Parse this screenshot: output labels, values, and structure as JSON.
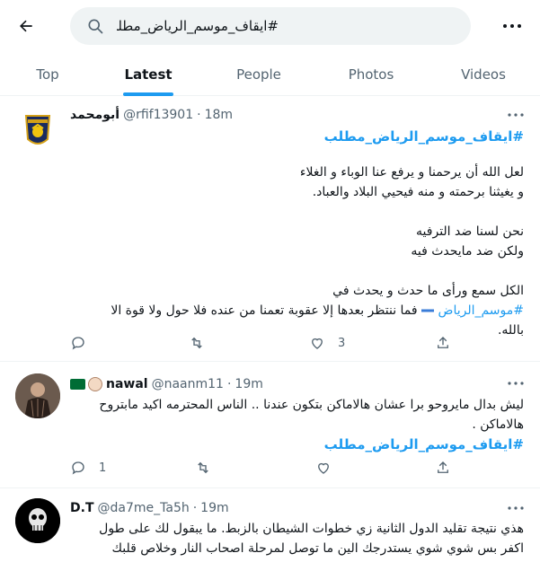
{
  "search": {
    "query": "#ايقاف_موسم_الرياض_مطلب"
  },
  "tabs": [
    {
      "label": "Top",
      "active": false
    },
    {
      "label": "Latest",
      "active": true
    },
    {
      "label": "People",
      "active": false
    },
    {
      "label": "Photos",
      "active": false
    },
    {
      "label": "Videos",
      "active": false
    }
  ],
  "tweets": [
    {
      "name": "أبومحمد",
      "handle": "@rfif13901",
      "time": "18m",
      "hashtag": "#ايقاف_موسم_الرياض_مطلب",
      "lines": [
        "لعل الله أن يرحمنا و يرفع عنا الوباء و الغلاء",
        "و يغيثنا برحمته و منه فيحيي البلاد والعباد.",
        "نحن لسنا ضد الترفيه",
        "ولكن ضد مايحدث فيه",
        "الكل سمع ورأى ما حدث و يحدث في"
      ],
      "link_hashtag": "#موسم_الرياض",
      "link_tail": "فما ننتظر بعدها إلا عقوبة تعمنا من عنده فلا حول ولا قوة الا",
      "last_line": "بالله.",
      "likes": "3"
    },
    {
      "name": "nawal",
      "handle": "@naanm11",
      "time": "19m",
      "lines": [
        "ليش بدال مايروحو برا عشان هالاماكن بتكون عندنا .. الناس المحترمه اكيد مابتروح",
        "هالاماكن ."
      ],
      "hashtag": "#ايقاف_موسم_الرياض_مطلب",
      "replies": "1"
    },
    {
      "name": "D.T",
      "handle": "@da7me_Ta5h",
      "time": "19m",
      "lines": [
        "هذي نتيجة تقليد الدول الثانية زي خطوات الشيطان بالزبط. ما يبقول لك على طول",
        "اكفر بس شوي شوي يستدرجك الين ما توصل لمرحلة اصحاب النار وخلاص قلبك"
      ]
    }
  ],
  "colors": {
    "accent": "#1d9bf0",
    "muted": "#536471",
    "text": "#0f1419"
  }
}
